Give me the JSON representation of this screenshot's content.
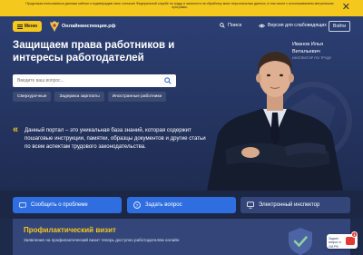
{
  "cookie_banner": {
    "text": "Продолжая пользоваться данным сайтом я подтверждаю свое согласие Федеральной службе по труду и занятости на обработку моих персональных данных, в том числе с использованием метрических программ."
  },
  "header": {
    "menu_label": "Меню",
    "logo_text": "Онлайнинспекция.рф",
    "search_label": "Поиск",
    "visually_impaired_label": "Версия для слабовидящих",
    "login_label": "Войти"
  },
  "hero": {
    "title": "Защищаем права работников и интересы работодателей",
    "search_placeholder": "Введите ваш вопрос...",
    "chips": [
      "Сверхурочные",
      "Задержка зарплаты",
      "Иностранные работники"
    ],
    "about_text": "Данный портал – это уникальная база знаний, которая содержит пошаговые инструкции, памятки, образцы документов и другие статьи по всем аспектам трудового законодательства.",
    "person_name": "Иванов Илья Витальевич",
    "person_role": "ИНСПЕКТОР ПО ТРУДУ"
  },
  "actions": {
    "report": "Сообщить о проблеме",
    "ask": "Задать вопрос",
    "inspector": "Электронный инспектор"
  },
  "preventive": {
    "title": "Профилактический визит",
    "text": "Заявление на профилактический визит теперь доступно работодателям онлайн"
  },
  "ask_widget": {
    "label": "Задать вопрос в ОИ.РФ",
    "badge": "1"
  },
  "colors": {
    "accent": "#f5c81d",
    "primary_button": "#2f6ee0",
    "hero_bg": "#2c3f73"
  }
}
